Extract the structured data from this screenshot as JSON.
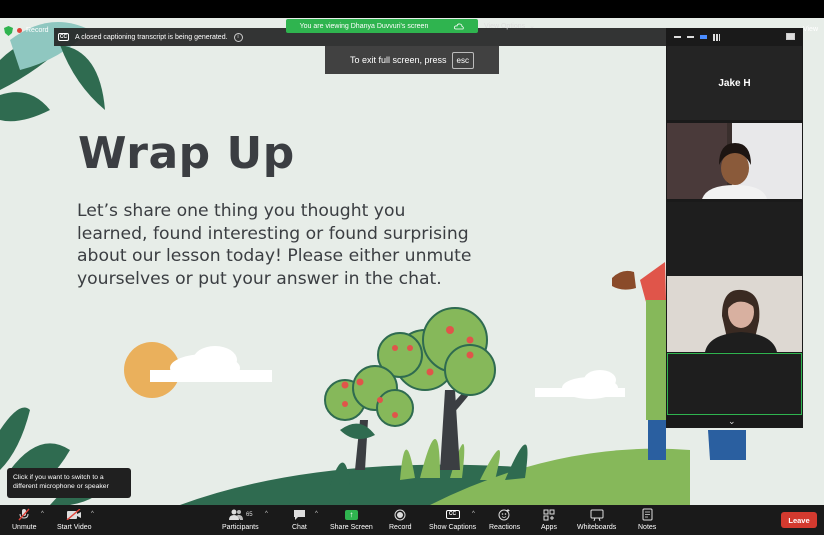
{
  "topbar": {
    "recording_label": "Record",
    "cc_message": "A closed captioning transcript is being generated.",
    "cc_icon_text": "CC",
    "share_banner": "You are viewing Dhanya Duvvuri's screen",
    "view_options": "View Options",
    "exit_fullscreen": "To exit full screen, press",
    "esc_key": "esc",
    "view_label": "View"
  },
  "slide": {
    "title": "Wrap Up",
    "body": "Let’s share one thing you thought you learned, found interesting or found surprising about our lesson today! Please either unmute yourselves or put your answer in the chat.",
    "colors": {
      "background": "#e7ede8",
      "text": "#3b3e42",
      "sun": "#eab05c",
      "leaf": "#2f6b50",
      "tree": "#86b85a",
      "fruit": "#e0554a"
    }
  },
  "gallery": {
    "tiles": [
      {
        "name": "Jake H"
      }
    ]
  },
  "tooltip": {
    "text": "Click if you want to switch to a different microphone or speaker"
  },
  "toolbar": {
    "unmute": "Unmute",
    "start_video": "Start Video",
    "participants": "Participants",
    "participant_count": "65",
    "chat": "Chat",
    "share_screen": "Share Screen",
    "record": "Record",
    "show_captions": "Show Captions",
    "reactions": "Reactions",
    "apps": "Apps",
    "whiteboards": "Whiteboards",
    "notes": "Notes",
    "leave": "Leave",
    "accent_color": "#2fb44f",
    "leave_color": "#d33a2f"
  }
}
